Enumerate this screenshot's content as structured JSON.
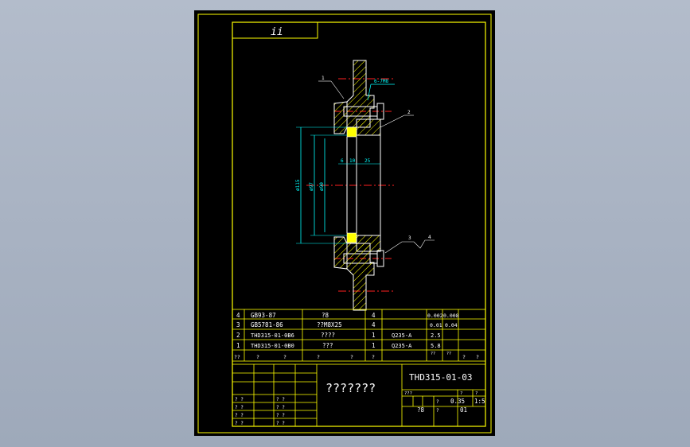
{
  "colors": {
    "background": "#a8b2c2",
    "sheet": "#000000",
    "frame": "#ffff00",
    "part": "#ffffff",
    "hatch": "#ffff00",
    "seal": "#ffff00",
    "centerline": "#ff2020",
    "dimension": "#00ffff"
  },
  "title_box_text": "ii",
  "part_labels": [
    "1",
    "2",
    "3",
    "4"
  ],
  "callout_top": "6-7M8",
  "dimensions": {
    "outer": "ø115",
    "middle": "ø97",
    "inner": "ø90",
    "d1": "6",
    "d2": "10",
    "d3": "25"
  },
  "bom_rows": [
    {
      "no": "4",
      "code": "GB93-87",
      "name": "?8",
      "qty": "4",
      "material": "",
      "w1": "0.002",
      "w2": "0.008"
    },
    {
      "no": "3",
      "code": "GB5781-86",
      "name": "??M8X25",
      "qty": "4",
      "material": "",
      "w1": "0.01",
      "w2": "0.04"
    },
    {
      "no": "2",
      "code": "THD315-01-0B6",
      "name": "????",
      "qty": "1",
      "material": "Q235-A",
      "w1": "2.5",
      "w2": ""
    },
    {
      "no": "1",
      "code": "THD315-01-0B0",
      "name": "???",
      "qty": "1",
      "material": "Q235-A",
      "w1": "5.8",
      "w2": ""
    }
  ],
  "bom_header": [
    "??",
    "?",
    "?",
    "?",
    "?",
    "?",
    "??",
    "??",
    "?",
    "?"
  ],
  "title_block": {
    "drawing_no": "THD315-01-03",
    "name": "???????",
    "scale_labels": [
      "???",
      "?",
      "?"
    ],
    "mass_label": "?",
    "mass": "0.35",
    "scale": "1:5",
    "sheet_label": "?",
    "sheet_no": "01",
    "cell_mark": "?8",
    "left_rows": [
      "? ?",
      "? ?",
      "? ?",
      "? ?"
    ],
    "mid_rows": [
      "? ?",
      "? ?",
      "? ?",
      "? ?"
    ]
  }
}
